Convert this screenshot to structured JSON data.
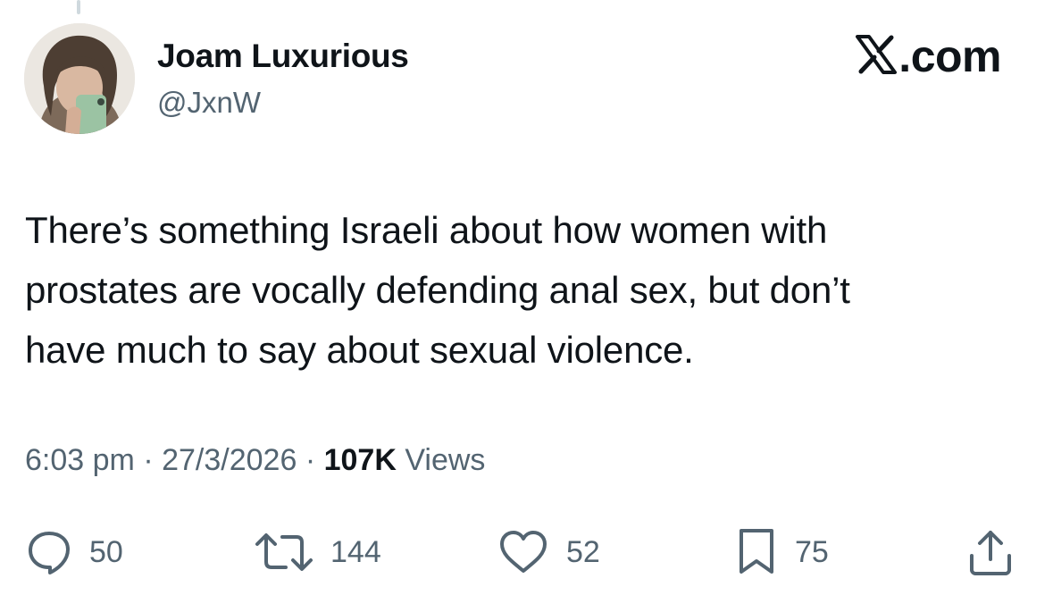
{
  "author": {
    "display_name": "Joam Luxurious",
    "handle": "@JxnW"
  },
  "brand": {
    "label": ".com",
    "icon": "x-logo-icon"
  },
  "tweet": {
    "line1": "There’s something Israeli about how women with",
    "line2": "prostates are vocally defending anal sex, but don’t",
    "line3": "have much to say about sexual violence."
  },
  "meta": {
    "time": "6:03 pm",
    "separator": "·",
    "date": "27/3/2026",
    "views_count": "107K",
    "views_label": "Views"
  },
  "actions": {
    "reply": {
      "icon": "reply-icon",
      "count": "50"
    },
    "retweet": {
      "icon": "retweet-icon",
      "count": "144"
    },
    "like": {
      "icon": "heart-icon",
      "count": "52"
    },
    "bookmark": {
      "icon": "bookmark-icon",
      "count": "75"
    },
    "share": {
      "icon": "share-icon"
    }
  },
  "colors": {
    "text_primary": "#0f1419",
    "text_secondary": "#536471",
    "thread_line": "#cfd9de"
  }
}
